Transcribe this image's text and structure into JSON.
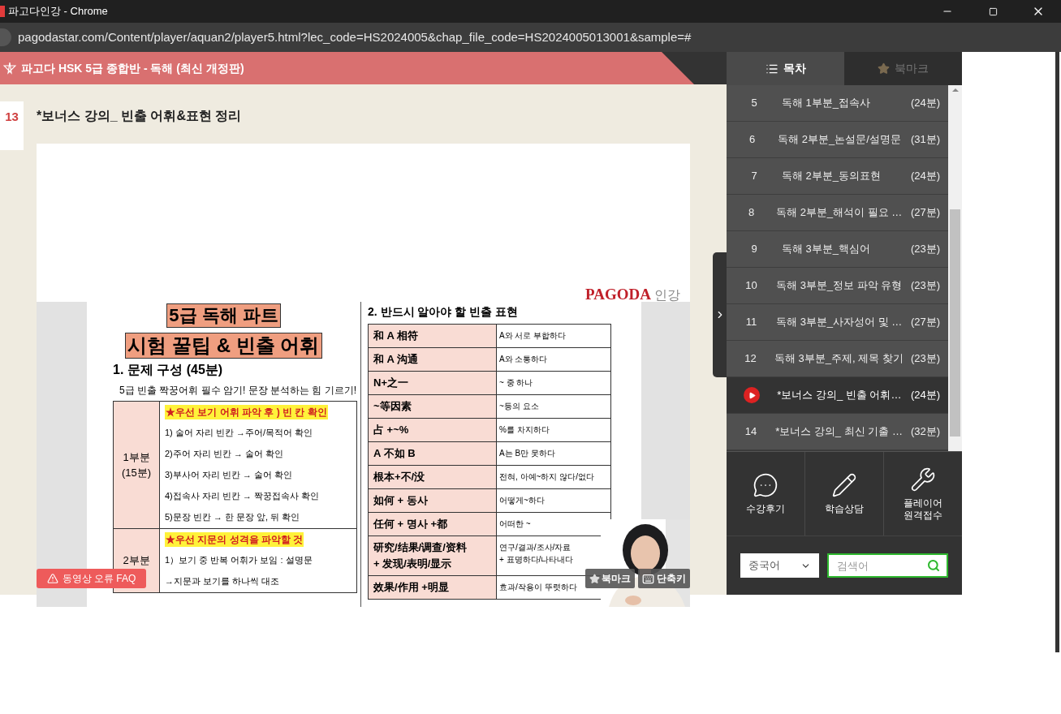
{
  "browser": {
    "title": "파고다인강 - Chrome",
    "url": "pagodastar.com/Content/player/aquan2/player5.html?lec_code=HS2024005&chap_file_code=HS2024005013001&sample=#"
  },
  "header": {
    "course_title": "파고다 HSK 5급 종합반 - 독해 (최신 개정판)"
  },
  "lesson": {
    "number": "13",
    "title": "*보너스 강의_ 빈출 어휘&표현 정리"
  },
  "slide": {
    "logo": "PAGODA",
    "logo_suffix": "인강",
    "heading_1": "5급 독해 파트",
    "heading_2": "시험 꿀팁 & 빈출 어휘",
    "section_1": "1. 문제 구성 (45분)",
    "subtitle": "5급 빈출 짝꿍어휘 필수 암기! 문장 분석하는 힘 기르기!",
    "parts": [
      {
        "label": "1부분",
        "duration": "(15분)",
        "tip": "★우선 보기 어휘 파악 후 ) 빈 칸 확인",
        "items": [
          "1) 술어 자리 빈칸 →주어/목적어 확인",
          "2)주어 자리 빈칸 → 술어 확인",
          "3)부사어 자리 빈칸 → 술어 확인",
          "4)접속사 자리 빈칸 → 짝꿍접속사 확인",
          "5)문장 빈칸 → 한 문장 앞, 뒤 확인"
        ]
      },
      {
        "label": "2부분",
        "tip": "★우선 지문의 성격을 파악할 것",
        "items": [
          "1）보기 중 반복 어휘가 보임 : 설명문",
          "→지문과 보기를 하나씩 대조"
        ]
      }
    ],
    "section_2": "2. 반드시 알아야 할 빈출 표현",
    "expressions": [
      {
        "chinese": "和 A 相符",
        "korean": "A와 서로 부합하다"
      },
      {
        "chinese": "和 A 沟通",
        "korean": "A와 소통하다"
      },
      {
        "chinese": "N+之一",
        "korean": "~ 중 하나"
      },
      {
        "chinese": "~等因素",
        "korean": "~등의 요소"
      },
      {
        "chinese": "占 +~%",
        "korean": "%를 차지하다"
      },
      {
        "chinese": "A 不如 B",
        "korean": "A는 B만 못하다"
      },
      {
        "chinese": "根本+不/没",
        "korean": "전혀, 아예~하지 않다/없다"
      },
      {
        "chinese": "如何 + 동사",
        "korean": "어떻게~하다"
      },
      {
        "chinese": "任何 + 명사 +都",
        "korean": "어떠한 ~"
      },
      {
        "chinese": "研究/结果/调查/资料\n+ 发现/表明/显示",
        "korean": "연구/결과/조사/자료\n+ 표명하다/나타내다"
      },
      {
        "chinese": "效果/作用 +明显",
        "korean": "효과/작용이 뚜렷하다"
      }
    ]
  },
  "video_overlay": {
    "faq_button": "동영상 오류 FAQ",
    "bookmark_button": "북마크",
    "shortcut_button": "단축키"
  },
  "sidebar": {
    "tabs": [
      {
        "label": "목차",
        "selected": true
      },
      {
        "label": "북마크",
        "selected": false
      }
    ],
    "chapters": [
      {
        "number": "5",
        "title": "독해 1부분_접속사",
        "duration": "(24분)",
        "selected": false
      },
      {
        "number": "6",
        "title": "독해 2부분_논설문/설명문",
        "duration": "(31분)",
        "selected": false
      },
      {
        "number": "7",
        "title": "독해 2부분_동의표현",
        "duration": "(24분)",
        "selected": false
      },
      {
        "number": "8",
        "title": "독해 2부분_해석이 필요 …",
        "duration": "(27분)",
        "selected": false
      },
      {
        "number": "9",
        "title": "독해 3부분_핵심어",
        "duration": "(23분)",
        "selected": false
      },
      {
        "number": "10",
        "title": "독해 3부분_정보 파악 유형",
        "duration": "(23분)",
        "selected": false
      },
      {
        "number": "11",
        "title": "독해 3부분_사자성어 및 …",
        "duration": "(27분)",
        "selected": false
      },
      {
        "number": "12",
        "title": "독해 3부분_주제, 제목 찾기",
        "duration": "(23분)",
        "selected": false
      },
      {
        "title": "*보너스 강의_ 빈출 어휘…",
        "duration": "(24분)",
        "selected": true
      },
      {
        "number": "14",
        "title": "*보너스 강의_ 최신 기출 …",
        "duration": "(32분)",
        "selected": false
      }
    ],
    "actions": [
      {
        "kind": "chat",
        "label": "수강후기"
      },
      {
        "kind": "pencil",
        "label": "학습상담"
      },
      {
        "kind": "wrench",
        "label": "플레이어\n원격접수"
      }
    ],
    "language_select": {
      "value": "중국어"
    },
    "search": {
      "placeholder": "검색어"
    }
  }
}
